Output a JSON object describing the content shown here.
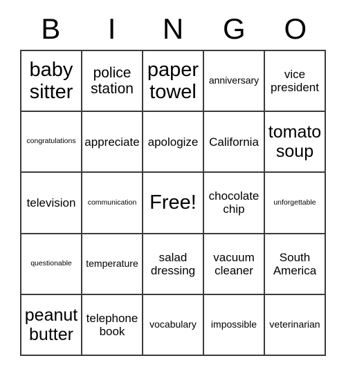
{
  "header": {
    "letters": [
      {
        "label": "B"
      },
      {
        "label": "I"
      },
      {
        "label": "N"
      },
      {
        "label": "G"
      },
      {
        "label": "O"
      }
    ]
  },
  "colors": {
    "background": "#ffffff",
    "text": "#000000",
    "grid_line": "#3a3a3a"
  },
  "grid": {
    "columns": 5,
    "rows": 5,
    "cells": [
      {
        "text": "baby sitter",
        "size": "fs-xxl"
      },
      {
        "text": "police station",
        "size": "fs-lg"
      },
      {
        "text": "paper towel",
        "size": "fs-xxl"
      },
      {
        "text": "anniversary",
        "size": "fs-sm"
      },
      {
        "text": "vice president",
        "size": "fs-md"
      },
      {
        "text": "congratulations",
        "size": "fs-xs"
      },
      {
        "text": "appreciate",
        "size": "fs-md"
      },
      {
        "text": "apologize",
        "size": "fs-md"
      },
      {
        "text": "California",
        "size": "fs-md"
      },
      {
        "text": "tomato soup",
        "size": "fs-xl"
      },
      {
        "text": "television",
        "size": "fs-md"
      },
      {
        "text": "communication",
        "size": "fs-xs"
      },
      {
        "text": "Free!",
        "size": "fs-xxl"
      },
      {
        "text": "chocolate chip",
        "size": "fs-md"
      },
      {
        "text": "unforgettable",
        "size": "fs-xs"
      },
      {
        "text": "questionable",
        "size": "fs-xs"
      },
      {
        "text": "temperature",
        "size": "fs-sm"
      },
      {
        "text": "salad dressing",
        "size": "fs-md"
      },
      {
        "text": "vacuum cleaner",
        "size": "fs-md"
      },
      {
        "text": "South America",
        "size": "fs-md"
      },
      {
        "text": "peanut butter",
        "size": "fs-xl"
      },
      {
        "text": "telephone book",
        "size": "fs-md"
      },
      {
        "text": "vocabulary",
        "size": "fs-sm"
      },
      {
        "text": "impossible",
        "size": "fs-sm"
      },
      {
        "text": "veterinarian",
        "size": "fs-sm"
      }
    ]
  }
}
